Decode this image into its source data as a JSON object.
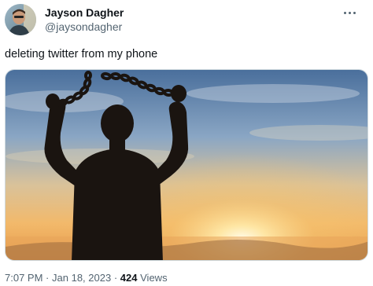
{
  "author": {
    "display_name": "Jayson Dagher",
    "handle": "@jaysondagher"
  },
  "tweet": {
    "text": "deleting twitter from my phone"
  },
  "meta": {
    "time": "7:07 PM",
    "separator_1": "·",
    "date": "Jan 18, 2023",
    "separator_2": "·",
    "views_count": "424",
    "views_label": "Views"
  },
  "icons": {
    "more": "more-horizontal-icon"
  },
  "colors": {
    "text_primary": "#0f1419",
    "text_secondary": "#536471",
    "border": "#cfd9de"
  }
}
